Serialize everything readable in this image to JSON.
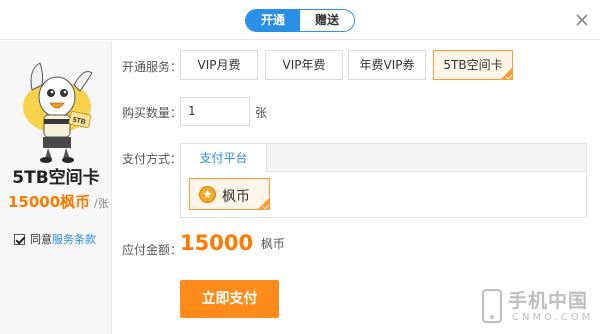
{
  "header": {
    "tabs": [
      {
        "label": "开通"
      },
      {
        "label": "赠送"
      }
    ]
  },
  "sidebar": {
    "card_name": "5TB空间卡",
    "price": "15000枫币",
    "unit": "/张",
    "agree_prefix": "同意",
    "agree_link": "服务条款",
    "agree_checked": true
  },
  "form": {
    "service_label": "开通服务：",
    "services": [
      {
        "label": "VIP月费"
      },
      {
        "label": "VIP年费"
      },
      {
        "label": "年费VIP券"
      },
      {
        "label": "5TB空间卡"
      }
    ],
    "selected_service": "5TB空间卡",
    "quantity_label": "购买数量：",
    "quantity_value": "1",
    "quantity_unit": "张",
    "payment_label": "支付方式：",
    "payment_tab": "支付平台",
    "payment_option": "枫币",
    "amount_label": "应付金额：",
    "amount_value": "15000",
    "amount_unit": "枫币",
    "pay_button": "立即支付"
  },
  "watermark": {
    "text": "手机中国",
    "sub": "CNMO.COM"
  },
  "colors": {
    "accent_blue": "#2a8fe6",
    "accent_orange": "#ff8c1a"
  },
  "icons": [
    "close-icon",
    "mascot-avatar",
    "coin-icon",
    "checkmark-icon"
  ]
}
